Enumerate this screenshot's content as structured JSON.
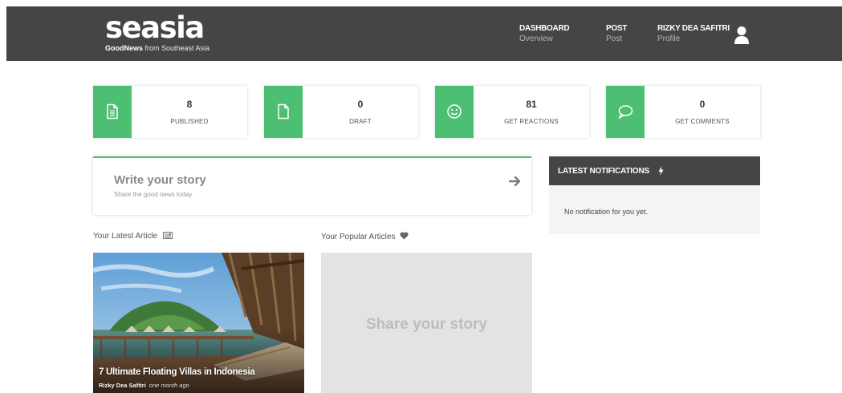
{
  "header": {
    "logo_text": "seasia",
    "tagline_bold": "GoodNews",
    "tagline_rest": " from Southeast Asia",
    "nav": [
      {
        "title": "DASHBOARD",
        "sub": "Overview"
      },
      {
        "title": "POST",
        "sub": "Post"
      },
      {
        "title": "RIZKY DEA SAFITRI",
        "sub": "Profile"
      }
    ]
  },
  "stats": [
    {
      "value": "8",
      "label": "PUBLISHED",
      "icon": "document-icon"
    },
    {
      "value": "0",
      "label": "DRAFT",
      "icon": "file-icon"
    },
    {
      "value": "81",
      "label": "GET REACTIONS",
      "icon": "smiley-icon"
    },
    {
      "value": "0",
      "label": "GET COMMENTS",
      "icon": "speech-bubble-icon"
    }
  ],
  "write": {
    "title": "Write your story",
    "subtitle": "Share the good news today"
  },
  "notifications": {
    "title": "LATEST NOTIFICATIONS",
    "empty_text": "No notification for you yet."
  },
  "latest": {
    "section_title": "Your Latest Article",
    "article_title": "7 Ultimate Floating Villas in Indonesia",
    "author": "Rizky Dea Safitri",
    "time": "one month ago"
  },
  "popular": {
    "section_title": "Your Popular Articles",
    "placeholder": "Share your story"
  },
  "colors": {
    "accent": "#4dbf72",
    "header_bg": "#454545"
  }
}
